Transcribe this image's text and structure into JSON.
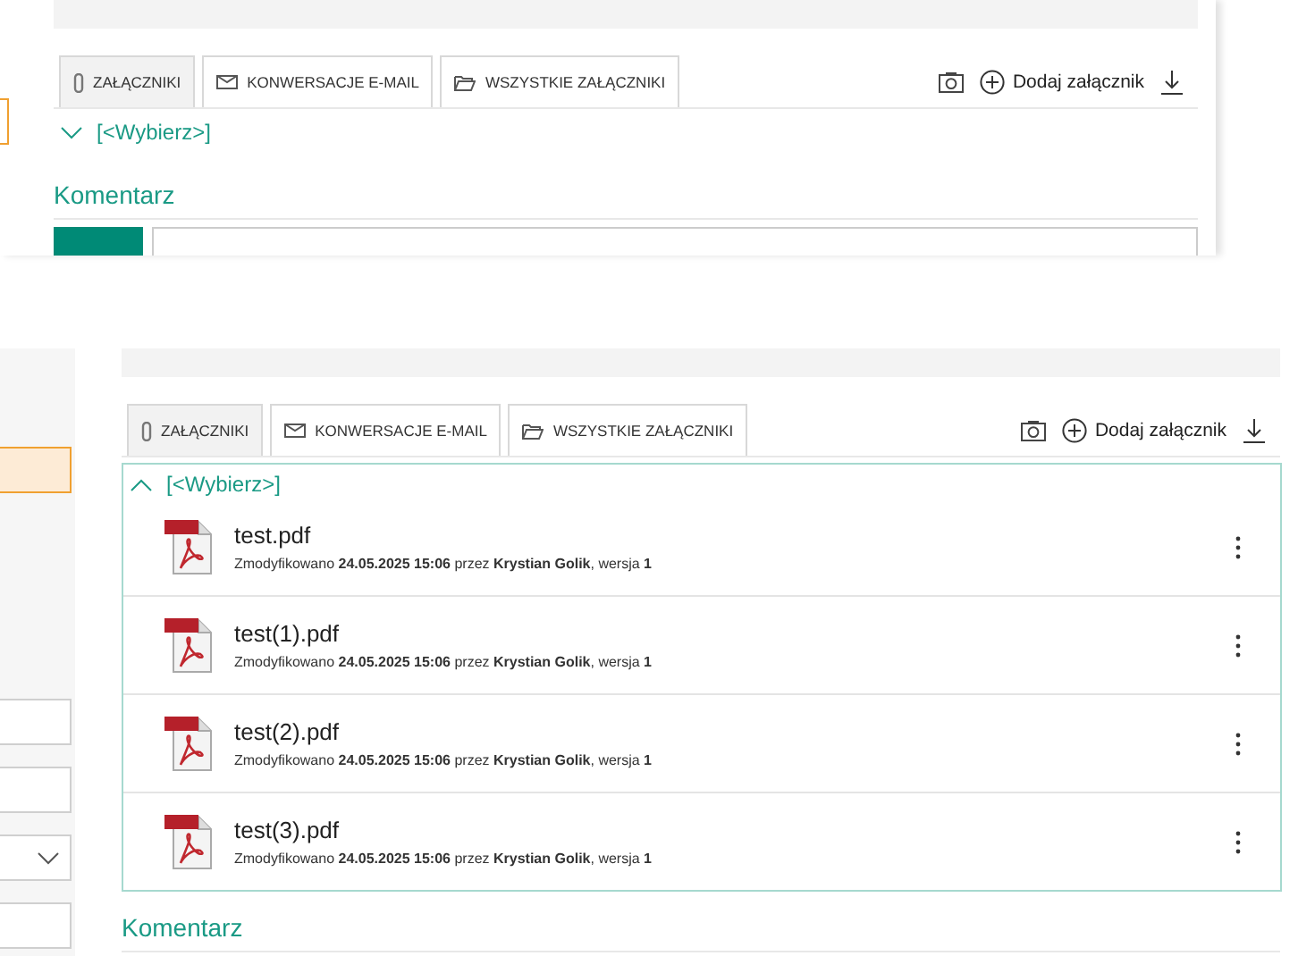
{
  "top_view": {
    "tabs": [
      {
        "label": "ZAŁĄCZNIKI",
        "kind": "attachments",
        "selected": true
      },
      {
        "label": "KONWERSACJE E-MAIL",
        "kind": "email",
        "selected": false
      },
      {
        "label": "WSZYSTKIE ZAŁĄCZNIKI",
        "kind": "all",
        "selected": false
      }
    ],
    "add_label": "Dodaj załącznik",
    "picker": {
      "label": "[<Wybierz>]",
      "expanded": false
    },
    "comment_title": "Komentarz"
  },
  "bottom_view": {
    "tabs": [
      {
        "label": "ZAŁĄCZNIKI",
        "kind": "attachments",
        "selected": true
      },
      {
        "label": "KONWERSACJE E-MAIL",
        "kind": "email",
        "selected": false
      },
      {
        "label": "WSZYSTKIE ZAŁĄCZNIKI",
        "kind": "all",
        "selected": false
      }
    ],
    "add_label": "Dodaj załącznik",
    "picker": {
      "label": "[<Wybierz>]",
      "expanded": true
    },
    "files": [
      {
        "name": "test.pdf",
        "meta": "Zmodyfikowano **24.05.2025 15:06** przez **Krystian Golik**, wersja **1**"
      },
      {
        "name": "test(1).pdf",
        "meta": "Zmodyfikowano **24.05.2025 15:06** przez **Krystian Golik**, wersja **1**"
      },
      {
        "name": "test(2).pdf",
        "meta": "Zmodyfikowano **24.05.2025 15:06** przez **Krystian Golik**, wersja **1**"
      },
      {
        "name": "test(3).pdf",
        "meta": "Zmodyfikowano **24.05.2025 15:06** przez **Krystian Golik**, wersja **1**"
      }
    ],
    "comment_title": "Komentarz"
  }
}
